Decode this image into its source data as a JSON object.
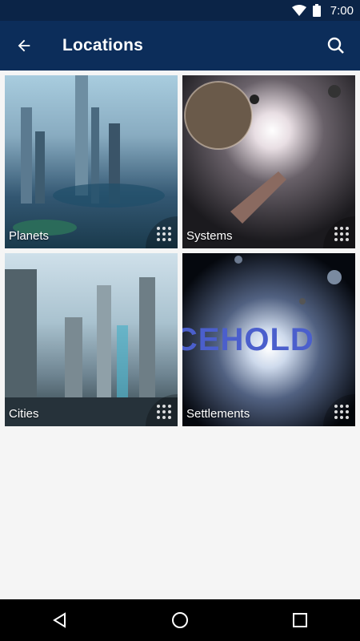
{
  "status_bar": {
    "time": "7:00"
  },
  "app_bar": {
    "title": "Locations"
  },
  "tiles": [
    {
      "label": "Planets"
    },
    {
      "label": "Systems"
    },
    {
      "label": "Cities"
    },
    {
      "label": "Settlements",
      "placeholder_text": "ACEHOLD"
    }
  ],
  "colors": {
    "status_bar": "#0b2447",
    "app_bar": "#0c2d5a",
    "background": "#f5f5f5",
    "nav_bar": "#000000"
  },
  "icons": {
    "back": "arrow-back-icon",
    "search": "search-icon",
    "wifi": "wifi-icon",
    "battery": "battery-icon"
  }
}
